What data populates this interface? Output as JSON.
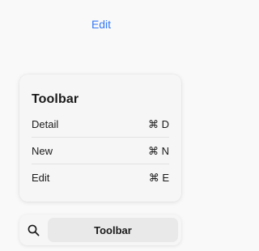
{
  "header": {
    "edit_label": "Edit"
  },
  "menu": {
    "title": "Toolbar",
    "items": [
      {
        "label": "Detail",
        "shortcut": "⌘ D"
      },
      {
        "label": "New",
        "shortcut": "⌘ N"
      },
      {
        "label": "Edit",
        "shortcut": "⌘ E"
      }
    ]
  },
  "bottom_bar": {
    "search_icon": "magnifying-glass",
    "selected_tab": "Toolbar"
  },
  "colors": {
    "accent": "#3478f6",
    "text": "#1a1a1a",
    "background": "#f9f9f9"
  }
}
